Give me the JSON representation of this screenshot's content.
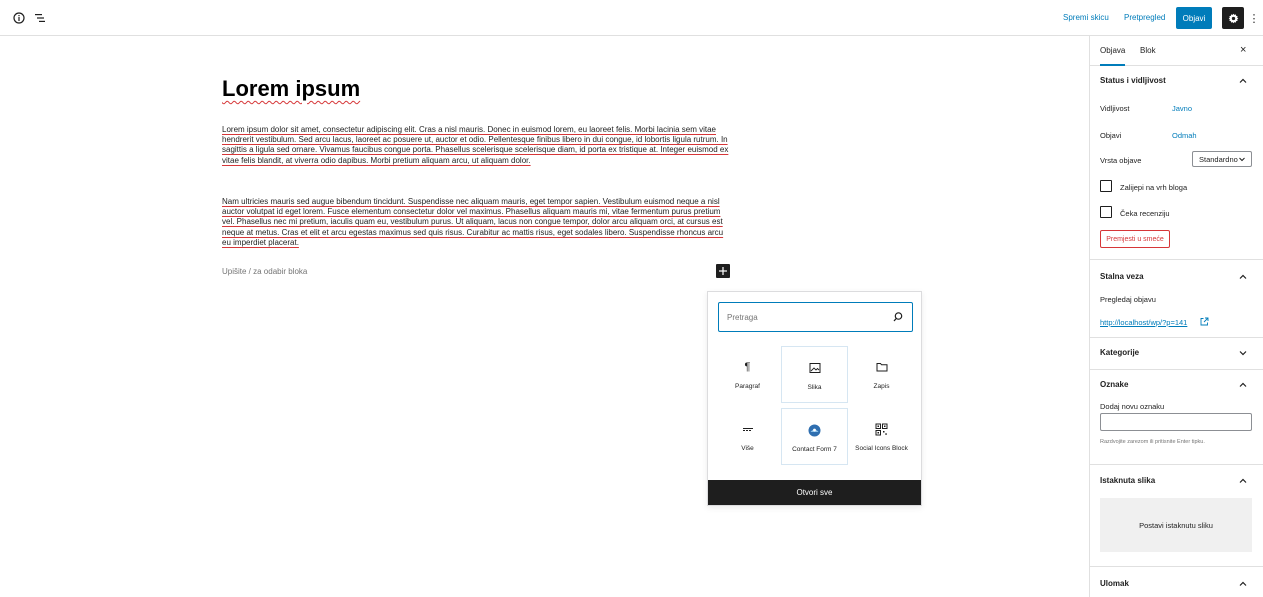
{
  "topbar": {
    "save_draft": "Spremi skicu",
    "preview": "Pretpregled",
    "publish": "Objavi"
  },
  "editor": {
    "title": "Lorem ipsum",
    "paragraphs": [
      "Lorem ipsum dolor sit amet, consectetur adipiscing elit. Cras a nisl mauris. Donec in euismod lorem, eu laoreet felis. Morbi lacinia sem vitae hendrerit vestibulum. Sed arcu lacus, laoreet ac posuere ut, auctor et odio. Pellentesque finibus libero in dui congue, id lobortis ligula rutrum. In sagittis a ligula sed ornare. Vivamus faucibus congue porta. Phasellus scelerisque scelerisque diam, id porta ex tristique at. Integer euismod ex vitae felis blandit, at viverra odio dapibus. Morbi pretium aliquam arcu, ut aliquam dolor.",
      "Nam ultricies mauris sed augue bibendum tincidunt. Suspendisse nec aliquam mauris, eget tempor sapien. Vestibulum euismod neque a nisl auctor volutpat id eget lorem. Fusce elementum consectetur dolor vel maximus. Phasellus aliquam mauris mi, vitae fermentum purus pretium vel. Phasellus nec mi pretium, iaculis quam eu, vestibulum purus. Ut aliquam, lacus non congue tempor, dolor arcu aliquam orci, at cursus est neque at metus. Cras et elit et arcu egestas maximus sed quis risus. Curabitur ac mattis risus, eget sodales libero. Suspendisse rhoncus arcu eu imperdiet placerat."
    ],
    "placeholder": "Upišite / za odabir bloka"
  },
  "inserter": {
    "search_placeholder": "Pretraga",
    "blocks": [
      {
        "label": "Paragraf",
        "icon": "paragraph-icon"
      },
      {
        "label": "Slika",
        "icon": "image-icon"
      },
      {
        "label": "Zapis",
        "icon": "folder-icon"
      },
      {
        "label": "Više",
        "icon": "more-icon"
      },
      {
        "label": "Contact Form 7",
        "icon": "contact-form-icon"
      },
      {
        "label": "Social Icons Block",
        "icon": "qr-icon"
      }
    ],
    "open_all": "Otvori sve"
  },
  "sidebar": {
    "tabs": [
      "Objava",
      "Blok"
    ],
    "status": {
      "title": "Status i vidljivost",
      "visibility_label": "Vidljivost",
      "visibility_value": "Javno",
      "publish_label": "Objavi",
      "publish_value": "Odmah",
      "format_label": "Vrsta objave",
      "format_value": "Standardno",
      "sticky_label": "Zalijepi na vrh bloga",
      "pending_label": "Čeka recenziju",
      "trash": "Premjesti u smeće"
    },
    "permalink": {
      "title": "Stalna veza",
      "label": "Pregledaj objavu",
      "url": "http://localhost/wp/?p=141"
    },
    "categories": {
      "title": "Kategorije"
    },
    "tags": {
      "title": "Oznake",
      "label": "Dodaj novu oznaku",
      "help": "Razdvojite zarezom ili pritisnite Enter tipku."
    },
    "featured": {
      "title": "Istaknuta slika",
      "button": "Postavi istaknutu sliku"
    },
    "excerpt": {
      "title": "Ulomak"
    }
  },
  "colors": {
    "accent": "#007cba",
    "danger": "#d63638",
    "dark": "#1e1e1e"
  }
}
